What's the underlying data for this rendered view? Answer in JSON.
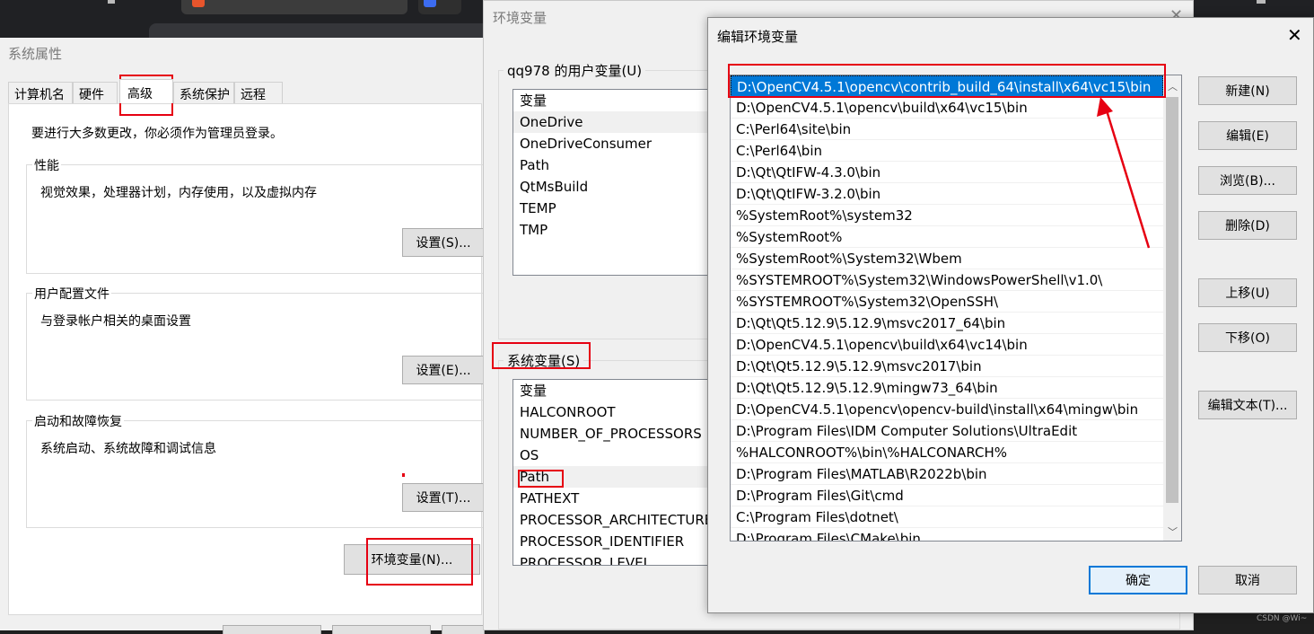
{
  "system_properties": {
    "title": "系统属性",
    "tabs": [
      "计算机名",
      "硬件",
      "高级",
      "系统保护",
      "远程"
    ],
    "active_tab": "高级",
    "admin_notice": "要进行大多数更改，你必须作为管理员登录。",
    "performance": {
      "label": "性能",
      "description": "视觉效果，处理器计划，内存使用，以及虚拟内存",
      "button": "设置(S)..."
    },
    "user_profiles": {
      "label": "用户配置文件",
      "description": "与登录帐户相关的桌面设置",
      "button": "设置(E)..."
    },
    "startup_recovery": {
      "label": "启动和故障恢复",
      "description": "系统启动、系统故障和调试信息",
      "button": "设置(T)..."
    },
    "env_vars_button": "环境变量(N)..."
  },
  "environment_variables": {
    "title": "环境变量",
    "user_vars_label": "qq978 的用户变量(U)",
    "user_vars_header": "变量",
    "user_vars": [
      "OneDrive",
      "OneDriveConsumer",
      "Path",
      "QtMsBuild",
      "TEMP",
      "TMP"
    ],
    "system_vars_label": "系统变量(S)",
    "system_vars_header": "变量",
    "system_vars": [
      "HALCONROOT",
      "NUMBER_OF_PROCESSORS",
      "OS",
      "Path",
      "PATHEXT",
      "PROCESSOR_ARCHITECTURE",
      "PROCESSOR_IDENTIFIER",
      "PROCESSOR_LEVEL"
    ]
  },
  "edit_dialog": {
    "title": "编辑环境变量",
    "selected_index": 0,
    "paths": [
      "D:\\OpenCV4.5.1\\opencv\\contrib_build_64\\install\\x64\\vc15\\bin",
      "D:\\OpenCV4.5.1\\opencv\\build\\x64\\vc15\\bin",
      "C:\\Perl64\\site\\bin",
      "C:\\Perl64\\bin",
      "D:\\Qt\\QtIFW-4.3.0\\bin",
      "D:\\Qt\\QtIFW-3.2.0\\bin",
      "%SystemRoot%\\system32",
      "%SystemRoot%",
      "%SystemRoot%\\System32\\Wbem",
      "%SYSTEMROOT%\\System32\\WindowsPowerShell\\v1.0\\",
      "%SYSTEMROOT%\\System32\\OpenSSH\\",
      "D:\\Qt\\Qt5.12.9\\5.12.9\\msvc2017_64\\bin",
      "D:\\OpenCV4.5.1\\opencv\\build\\x64\\vc14\\bin",
      "D:\\Qt\\Qt5.12.9\\5.12.9\\msvc2017\\bin",
      "D:\\Qt\\Qt5.12.9\\5.12.9\\mingw73_64\\bin",
      "D:\\OpenCV4.5.1\\opencv\\opencv-build\\install\\x64\\mingw\\bin",
      "D:\\Program Files\\IDM Computer Solutions\\UltraEdit",
      "%HALCONROOT%\\bin\\%HALCONARCH%",
      "D:\\Program Files\\MATLAB\\R2022b\\bin",
      "D:\\Program Files\\Git\\cmd",
      "C:\\Program Files\\dotnet\\",
      "D:\\Program Files\\CMake\\bin"
    ],
    "buttons": {
      "new": "新建(N)",
      "edit": "编辑(E)",
      "browse": "浏览(B)...",
      "delete": "删除(D)",
      "move_up": "上移(U)",
      "move_down": "下移(O)",
      "edit_text": "编辑文本(T)...",
      "ok": "确定",
      "cancel": "取消"
    }
  },
  "watermark": "CSDN @Wi~",
  "colors": {
    "selection": "#0078d7",
    "annotation_red": "#e60012"
  }
}
